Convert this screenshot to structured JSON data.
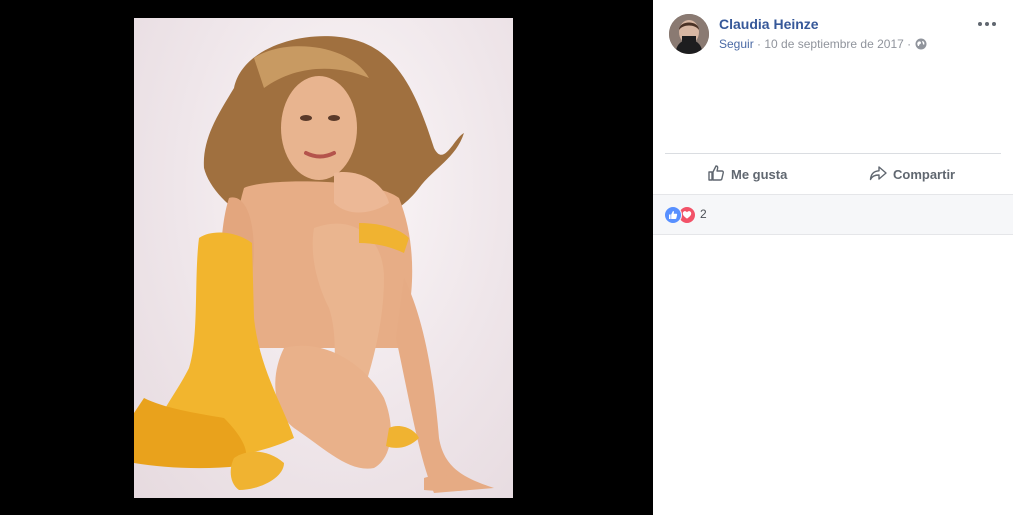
{
  "post": {
    "author": "Claudia Heinze",
    "follow_label": "Seguir",
    "separator": "·",
    "date": "10 de septiembre de 2017",
    "privacy_icon": "globe-icon"
  },
  "actions": {
    "like_label": "Me gusta",
    "share_label": "Compartir"
  },
  "reactions": {
    "count": "2",
    "icons": [
      "like-icon",
      "love-icon"
    ]
  },
  "colors": {
    "link": "#365899",
    "muted": "#90949c",
    "like_blue": "#5890ff",
    "love_red": "#f25268",
    "dress_gold": "#f2b52e"
  }
}
